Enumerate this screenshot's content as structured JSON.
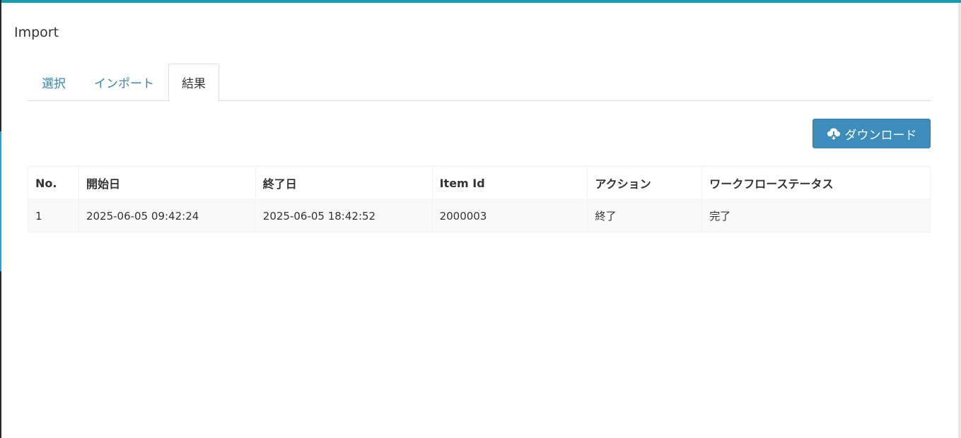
{
  "page": {
    "title": "Import"
  },
  "tabs": [
    {
      "label": "選択",
      "active": false
    },
    {
      "label": "インポート",
      "active": false
    },
    {
      "label": "結果",
      "active": true
    }
  ],
  "toolbar": {
    "download_label": "ダウンロード",
    "download_icon": "cloud-download-icon"
  },
  "table": {
    "headers": {
      "no": "No.",
      "start_date": "開始日",
      "end_date": "終了日",
      "item_id": "Item Id",
      "action": "アクション",
      "workflow_status": "ワークフローステータス"
    },
    "rows": [
      {
        "no": "1",
        "start_date": "2025-06-05 09:42:24",
        "end_date": "2025-06-05 18:42:52",
        "item_id": "2000003",
        "action": "終了",
        "workflow_status": "完了"
      }
    ]
  },
  "colors": {
    "accent_top": "#1a9cb0",
    "link": "#3a87ad",
    "button_primary": "#3c8dbc"
  }
}
